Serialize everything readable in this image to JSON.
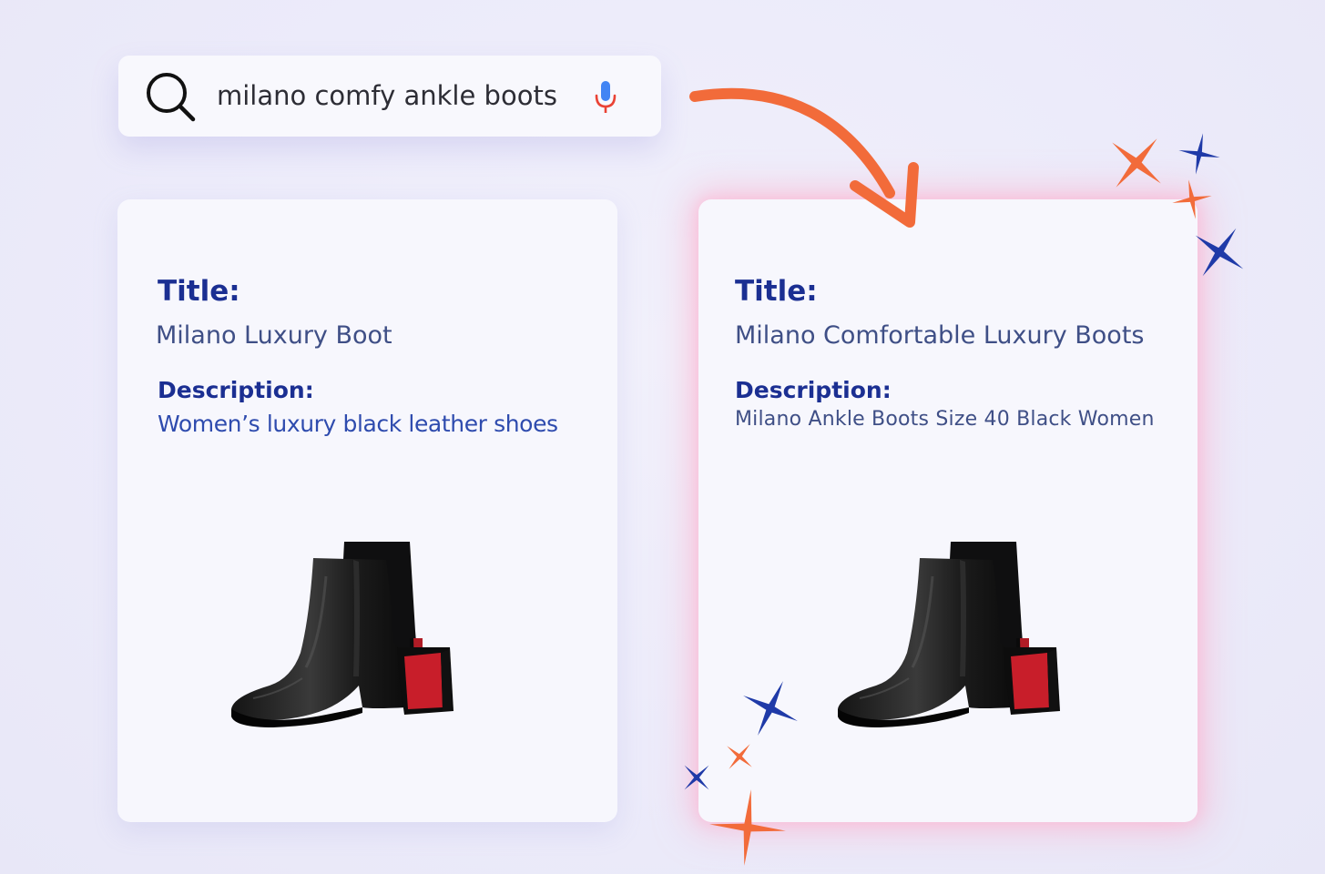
{
  "search": {
    "query": "milano comfy ankle boots",
    "search_icon": "search-icon",
    "mic_icon": "microphone-icon"
  },
  "cards": {
    "original": {
      "title_label": "Title:",
      "title": "Milano Luxury Boot",
      "description_label": "Description:",
      "description": "Women’s luxury black leather shoes",
      "image": "black-ankle-boots-red-heel"
    },
    "optimized": {
      "title_label": "Title:",
      "title": "Milano Comfortable Luxury Boots",
      "description_label": "Description:",
      "description": "Milano Ankle Boots Size 40 Black Women",
      "image": "black-ankle-boots-red-heel"
    }
  },
  "decorations": {
    "arrow_icon": "curved-arrow-icon",
    "sparkle_icon": "sparkle-icon"
  },
  "colors": {
    "background": "#eceaf9",
    "card": "#f7f7fd",
    "label": "#1b2f92",
    "value_text": "#3f4f86",
    "accent_orange": "#f26b3a",
    "accent_blue": "#1f3aa8",
    "highlight_glow": "#ffb4cc",
    "boot_heel_red": "#c81e2a"
  }
}
